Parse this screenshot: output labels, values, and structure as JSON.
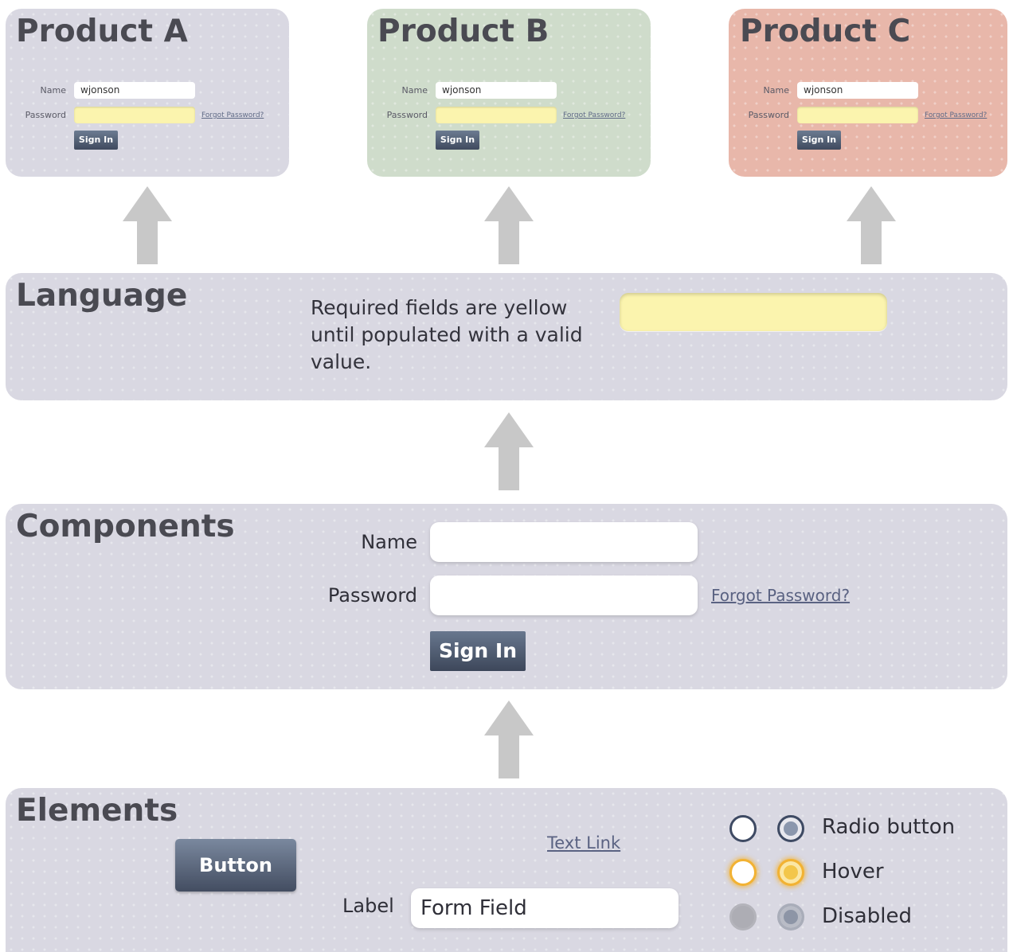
{
  "products": [
    {
      "title": "Product A",
      "name_label": "Name",
      "name_value": "wjonson",
      "password_label": "Password",
      "forgot_label": "Forgot Password?",
      "signin_label": "Sign In"
    },
    {
      "title": "Product B",
      "name_label": "Name",
      "name_value": "wjonson",
      "password_label": "Password",
      "forgot_label": "Forgot Password?",
      "signin_label": "Sign In"
    },
    {
      "title": "Product C",
      "name_label": "Name",
      "name_value": "wjonson",
      "password_label": "Password",
      "forgot_label": "Forgot Password?",
      "signin_label": "Sign In"
    }
  ],
  "language": {
    "title": "Language",
    "description": "Required fields are yellow until populated with a valid value."
  },
  "components": {
    "title": "Components",
    "name_label": "Name",
    "password_label": "Password",
    "forgot_label": "Forgot Password?",
    "signin_label": "Sign In"
  },
  "elements": {
    "title": "Elements",
    "button_label": "Button",
    "text_link": "Text Link",
    "field_label": "Label",
    "field_value": "Form Field",
    "radio_label": "Radio button",
    "hover_label": "Hover",
    "disabled_label": "Disabled"
  },
  "colors": {
    "panel": "#d9d8e2",
    "product_b": "#cfdccb",
    "product_c": "#e8b7aa",
    "required_yellow": "#fbf4ae",
    "button": "#4a566b",
    "arrow": "#c8c8c8"
  }
}
